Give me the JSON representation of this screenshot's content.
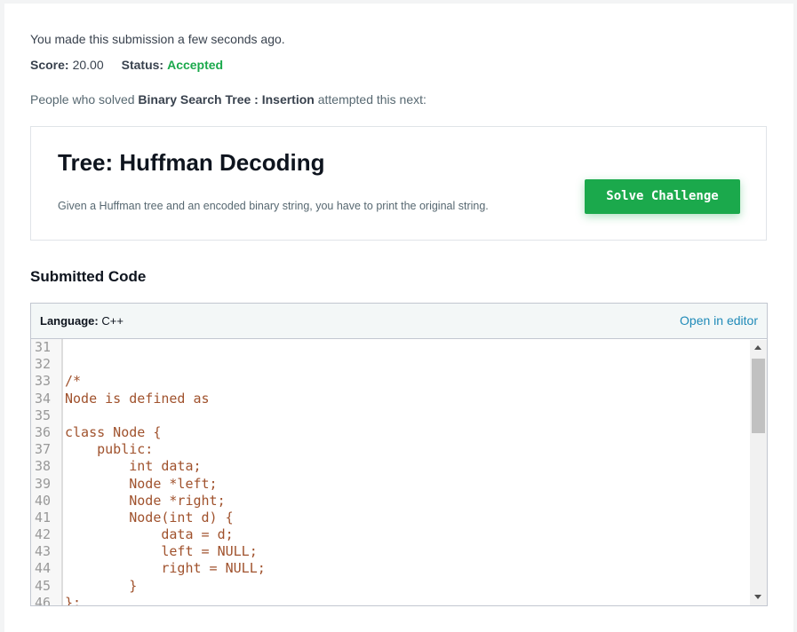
{
  "submission": {
    "message": "You made this submission a few seconds ago.",
    "score_label": "Score:",
    "score_value": "20.00",
    "status_label": "Status:",
    "status_value": "Accepted"
  },
  "recommendation": {
    "prefix": "People who solved ",
    "problem_name": "Binary Search Tree : Insertion",
    "suffix": " attempted this next:"
  },
  "next_challenge": {
    "title": "Tree: Huffman Decoding",
    "description": "Given a Huffman tree and an encoded binary string, you have to print the original string.",
    "button_label": "Solve Challenge"
  },
  "submitted_code": {
    "heading": "Submitted Code",
    "language_label": "Language:",
    "language_value": "C++",
    "open_editor_label": "Open in editor",
    "lines": [
      {
        "num": "31",
        "text": ""
      },
      {
        "num": "32",
        "text": ""
      },
      {
        "num": "33",
        "text": "/*"
      },
      {
        "num": "34",
        "text": "Node is defined as"
      },
      {
        "num": "35",
        "text": ""
      },
      {
        "num": "36",
        "text": "class Node {"
      },
      {
        "num": "37",
        "text": "    public:"
      },
      {
        "num": "38",
        "text": "        int data;"
      },
      {
        "num": "39",
        "text": "        Node *left;"
      },
      {
        "num": "40",
        "text": "        Node *right;"
      },
      {
        "num": "41",
        "text": "        Node(int d) {"
      },
      {
        "num": "42",
        "text": "            data = d;"
      },
      {
        "num": "43",
        "text": "            left = NULL;"
      },
      {
        "num": "44",
        "text": "            right = NULL;"
      },
      {
        "num": "45",
        "text": "        }"
      },
      {
        "num": "46",
        "text": "};"
      }
    ]
  },
  "colors": {
    "accepted": "#1ba94c",
    "button_bg": "#1ba94c",
    "link": "#1f8ab8",
    "code_text": "#a0522d"
  },
  "icons": {
    "scroll_up": "triangle-up-icon",
    "scroll_down": "triangle-down-icon"
  }
}
